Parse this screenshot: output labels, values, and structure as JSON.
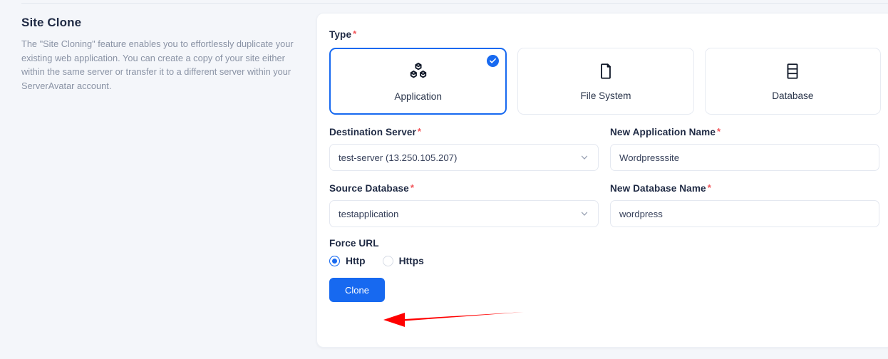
{
  "info_panel": {
    "title": "Site Clone",
    "description": "The \"Site Cloning\" feature enables you to effortlessly duplicate your existing web application. You can create a copy of your site either within the same server or transfer it to a different server within your ServerAvatar account."
  },
  "form": {
    "type": {
      "label": "Type",
      "required_marker": "*",
      "options": [
        {
          "label": "Application",
          "icon": "cubes-icon",
          "selected": true
        },
        {
          "label": "File System",
          "icon": "file-icon",
          "selected": false
        },
        {
          "label": "Database",
          "icon": "database-icon",
          "selected": false
        }
      ]
    },
    "destination_server": {
      "label": "Destination Server",
      "required_marker": "*",
      "value": "test-server (13.250.105.207)"
    },
    "new_application_name": {
      "label": "New Application Name",
      "required_marker": "*",
      "value": "Wordpresssite",
      "placeholder": "New Application Name"
    },
    "source_database": {
      "label": "Source Database",
      "required_marker": "*",
      "value": "testapplication"
    },
    "new_database_name": {
      "label": "New Database Name",
      "required_marker": "*",
      "value": "wordpress",
      "placeholder": "New Database Name"
    },
    "force_url": {
      "label": "Force URL",
      "options": [
        {
          "label": "Http",
          "selected": true
        },
        {
          "label": "Https",
          "selected": false
        }
      ]
    },
    "submit": {
      "label": "Clone"
    }
  },
  "annotation": {
    "arrow": "red-arrow-pointing-to-clone-button"
  },
  "colors": {
    "accent": "#1769f0",
    "required": "#f2555a",
    "page_bg": "#f4f6fa",
    "card_bg": "#ffffff",
    "text": "#1f2a44",
    "muted_text": "#8a93a5",
    "annotation": "#ff0000"
  }
}
